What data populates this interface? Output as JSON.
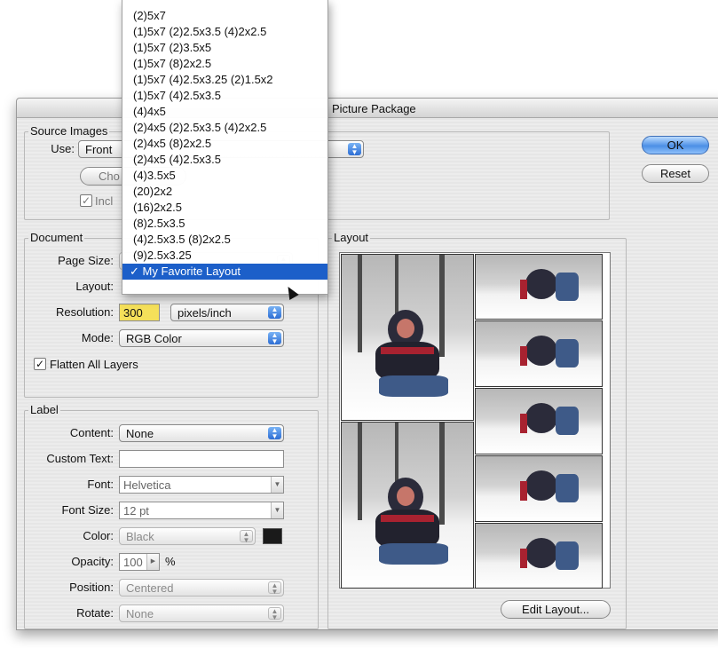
{
  "dialog": {
    "title": "Picture Package",
    "ok_label": "OK",
    "reset_label": "Reset"
  },
  "source": {
    "legend": "Source Images",
    "use_label": "Use:",
    "use_value": "Front",
    "choose_label": "Cho",
    "include_label": "Incl",
    "include_checked": true
  },
  "document": {
    "legend": "Document",
    "page_size_label": "Page Size:",
    "layout_label": "Layout:",
    "resolution_label": "Resolution:",
    "resolution_value": "300",
    "resolution_unit": "pixels/inch",
    "mode_label": "Mode:",
    "mode_value": "RGB Color",
    "flatten_label": "Flatten All Layers",
    "flatten_checked": true
  },
  "label": {
    "legend": "Label",
    "content_label": "Content:",
    "content_value": "None",
    "custom_text_label": "Custom Text:",
    "custom_text_value": "",
    "font_label": "Font:",
    "font_value": "Helvetica",
    "font_size_label": "Font Size:",
    "font_size_value": "12 pt",
    "color_label": "Color:",
    "color_value": "Black",
    "color_swatch": "#1a1a1a",
    "opacity_label": "Opacity:",
    "opacity_value": "100",
    "opacity_unit": "%",
    "position_label": "Position:",
    "position_value": "Centered",
    "rotate_label": "Rotate:",
    "rotate_value": "None"
  },
  "layout_panel": {
    "legend": "Layout",
    "edit_button": "Edit Layout..."
  },
  "layout_menu": {
    "items": [
      "(2)5x7",
      "(1)5x7 (2)2.5x3.5 (4)2x2.5",
      "(1)5x7 (2)3.5x5",
      "(1)5x7 (8)2x2.5",
      "(1)5x7 (4)2.5x3.25 (2)1.5x2",
      "(1)5x7 (4)2.5x3.5",
      "(4)4x5",
      "(2)4x5 (2)2.5x3.5 (4)2x2.5",
      "(2)4x5 (8)2x2.5",
      "(2)4x5 (4)2.5x3.5",
      "(4)3.5x5",
      "(20)2x2",
      "(16)2x2.5",
      "(8)2.5x3.5",
      "(4)2.5x3.5 (8)2x2.5",
      "(9)2.5x3.25"
    ],
    "selected": "✓ My Favorite Layout"
  },
  "colors": {
    "accent": "#1c5fc9",
    "highlight_field": "#f5e05a"
  }
}
